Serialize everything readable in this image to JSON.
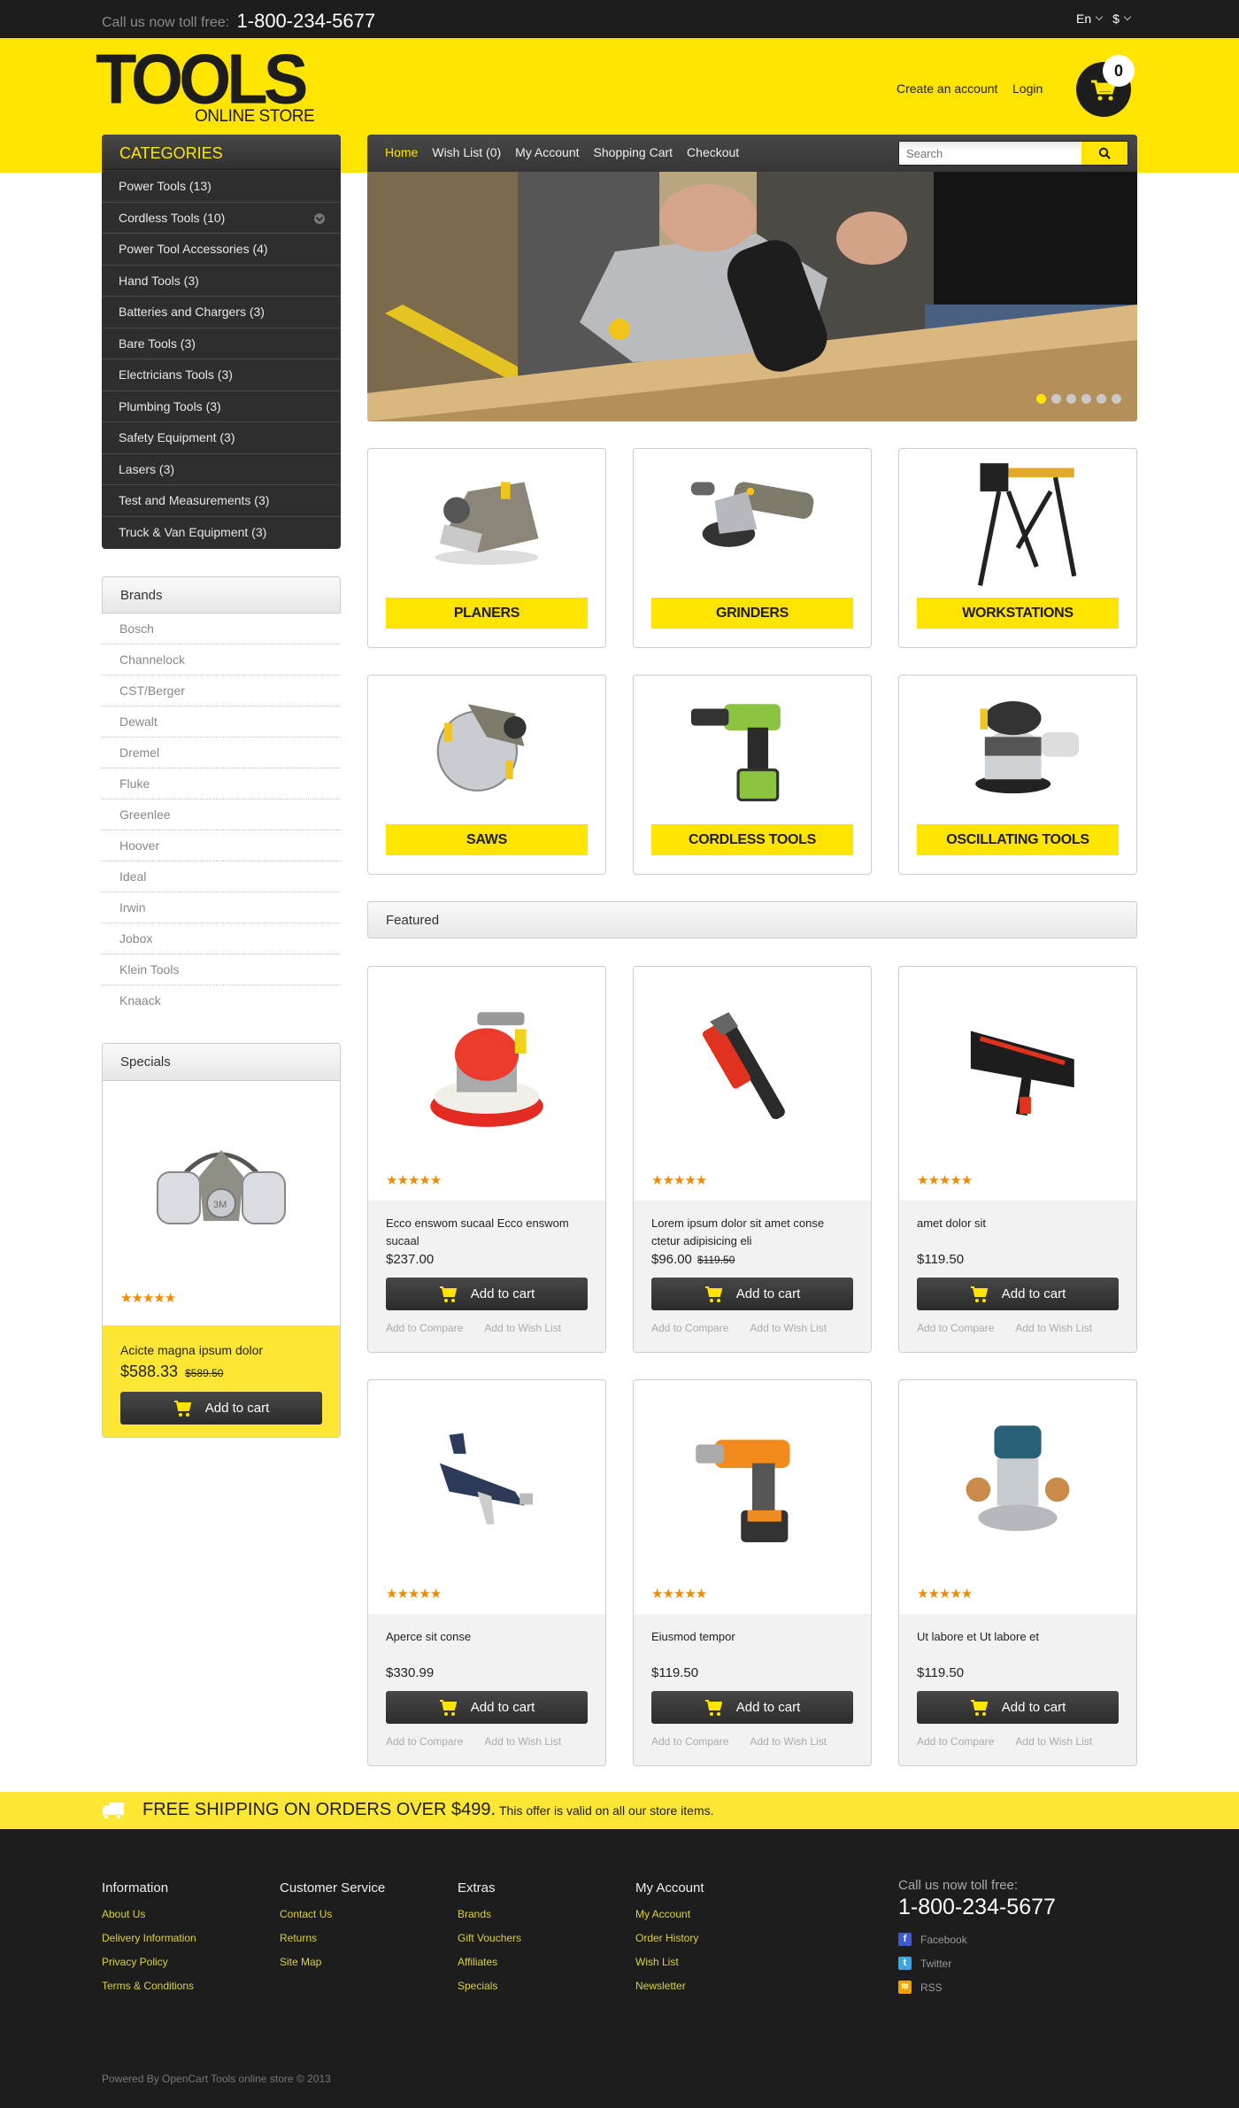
{
  "topbar": {
    "call_label": "Call us now toll free:",
    "phone": "1-800-234-5677",
    "language": "En",
    "currency": "$"
  },
  "header": {
    "logo_main": "TOOLS",
    "logo_sub": "ONLINE STORE",
    "create_account": "Create an account",
    "login": "Login",
    "cart_count": "0"
  },
  "nav": {
    "links": [
      "Home",
      "Wish List (0)",
      "My Account",
      "Shopping Cart",
      "Checkout"
    ],
    "active": "Home",
    "search_placeholder": "Search"
  },
  "categories": {
    "title": "CATEGORIES",
    "items": [
      {
        "label": "Power Tools (13)"
      },
      {
        "label": "Cordless Tools (10)",
        "expandable": true
      },
      {
        "label": "Power Tool Accessories (4)"
      },
      {
        "label": "Hand Tools (3)"
      },
      {
        "label": "Batteries and Chargers (3)"
      },
      {
        "label": "Bare Tools (3)"
      },
      {
        "label": "Electricians Tools (3)"
      },
      {
        "label": "Plumbing Tools (3)"
      },
      {
        "label": "Safety Equipment (3)"
      },
      {
        "label": "Lasers (3)"
      },
      {
        "label": "Test and Measurements (3)"
      },
      {
        "label": "Truck & Van Equipment (3)"
      }
    ]
  },
  "brands": {
    "title": "Brands",
    "items": [
      "Bosch",
      "Channelock",
      "CST/Berger",
      "Dewalt",
      "Dremel",
      "Fluke",
      "Greenlee",
      "Hoover",
      "Ideal",
      "Irwin",
      "Jobox",
      "Klein Tools",
      "Knaack"
    ]
  },
  "specials": {
    "title": "Specials",
    "product": {
      "name": "Acicte magna ipsum dolor",
      "price": "$588.33",
      "old_price": "$589.50",
      "rating": 5,
      "image": "respirator-mask",
      "add_to_cart": "Add to cart"
    }
  },
  "slider": {
    "slide_count": 6,
    "active_index": 0,
    "image": "belt-sander-on-wood"
  },
  "category_tiles": [
    {
      "label": "PLANERS",
      "image": "planer"
    },
    {
      "label": "GRINDERS",
      "image": "angle-grinder"
    },
    {
      "label": "WORKSTATIONS",
      "image": "workstation"
    },
    {
      "label": "SAWS",
      "image": "circular-saw"
    },
    {
      "label": "CORDLESS TOOLS",
      "image": "cordless-drill"
    },
    {
      "label": "OSCILLATING TOOLS",
      "image": "orbital-sander"
    }
  ],
  "featured": {
    "title": "Featured",
    "add_to_cart": "Add to cart",
    "add_to_compare": "Add to Compare",
    "add_to_wishlist": "Add to Wish List",
    "products": [
      {
        "name": "Ecco enswom sucaal Ecco enswom sucaal",
        "price": "$237.00",
        "old_price": "",
        "rating": 5,
        "image": "red-orbital-sander"
      },
      {
        "name": "Lorem ipsum dolor sit amet conse ctetur adipisicing eli",
        "price": "$96.00",
        "old_price": "$119.50",
        "rating": 5,
        "image": "pipe-wrench"
      },
      {
        "name": "amet dolor sit",
        "price": "$119.50",
        "old_price": "",
        "rating": 5,
        "image": "caulk-gun"
      },
      {
        "name": "Aperce sit conse",
        "price": "$330.99",
        "old_price": "",
        "rating": 5,
        "image": "spray-gun"
      },
      {
        "name": "Eiusmod tempor",
        "price": "$119.50",
        "old_price": "",
        "rating": 5,
        "image": "orange-drill"
      },
      {
        "name": "Ut labore et Ut labore et",
        "price": "$119.50",
        "old_price": "",
        "rating": 5,
        "image": "router"
      }
    ]
  },
  "shipping": {
    "headline": "FREE SHIPPING ON ORDERS OVER $499.",
    "note": "This offer is valid on all our store items."
  },
  "footer": {
    "columns": [
      {
        "title": "Information",
        "links": [
          "About Us",
          "Delivery Information",
          "Privacy Policy",
          "Terms & Conditions"
        ]
      },
      {
        "title": "Customer Service",
        "links": [
          "Contact Us",
          "Returns",
          "Site Map"
        ]
      },
      {
        "title": "Extras",
        "links": [
          "Brands",
          "Gift Vouchers",
          "Affiliates",
          "Specials"
        ]
      },
      {
        "title": "My Account",
        "links": [
          "My Account",
          "Order History",
          "Wish List",
          "Newsletter"
        ]
      }
    ],
    "call_label": "Call us now toll free:",
    "phone": "1-800-234-5677",
    "social": [
      {
        "label": "Facebook",
        "icon": "facebook-icon",
        "color": "#3b5bd6",
        "glyph": "f"
      },
      {
        "label": "Twitter",
        "icon": "twitter-icon",
        "color": "#3ba6e6",
        "glyph": "t"
      },
      {
        "label": "RSS",
        "icon": "rss-icon",
        "color": "#f5a000",
        "glyph": "≋"
      }
    ],
    "copyright": "Powered By OpenCart Tools online store © 2013"
  },
  "colors": {
    "accent": "#ffe400",
    "dark": "#1d1d1d",
    "star": "#f08a00"
  }
}
